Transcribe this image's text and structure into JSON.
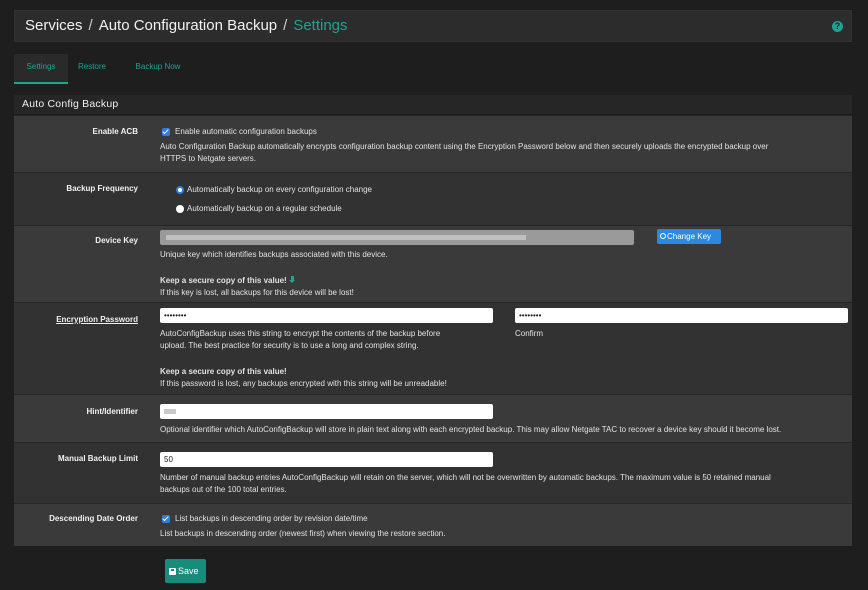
{
  "header": {
    "crumb1": "Services",
    "crumb2": "Auto Configuration Backup",
    "crumb3": "Settings",
    "help_icon": "?"
  },
  "tabs": [
    {
      "label": "Settings",
      "active": true
    },
    {
      "label": "Restore",
      "active": false
    },
    {
      "label": "Backup Now",
      "active": false
    }
  ],
  "panel": {
    "title": "Auto Config Backup"
  },
  "enable_acb": {
    "label": "Enable ACB",
    "checkbox_label": "Enable automatic configuration backups",
    "checked": true,
    "help1": "Auto Configuration Backup automatically encrypts configuration backup content using the Encryption Password below and then securely uploads the encrypted backup over",
    "help2": "HTTPS to Netgate servers."
  },
  "frequency": {
    "label": "Backup Frequency",
    "option1": "Automatically backup on every configuration change",
    "option2": "Automatically backup on a regular schedule",
    "selected": 0
  },
  "device_key": {
    "label": "Device Key",
    "button": "Change Key",
    "help": "Unique key which identifies backups associated with this device.",
    "warn_title": "Keep a secure copy of this value!",
    "warn_text": "If this key is lost, all backups for this device will be lost!"
  },
  "encryption": {
    "label": "Encryption Password",
    "value": "••••••••",
    "confirm_value": "••••••••",
    "confirm_label": "Confirm",
    "help1": "AutoConfigBackup uses this string to encrypt the contents of the backup before",
    "help2": "upload. The best practice for security is to use a long and complex string.",
    "warn_title": "Keep a secure copy of this value!",
    "warn_text": "If this password is lost, any backups encrypted with this string will be unreadable!"
  },
  "hint": {
    "label": "Hint/Identifier",
    "help": "Optional identifier which AutoConfigBackup will store in plain text along with each encrypted backup. This may allow Netgate TAC to recover a device key should it become lost."
  },
  "manual_limit": {
    "label": "Manual Backup Limit",
    "value": "50",
    "help1": "Number of manual backup entries AutoConfigBackup will retain on the server, which will not be overwritten by automatic backups. The maximum value is 50 retained manual",
    "help2": "backups out of the 100 total entries."
  },
  "descending": {
    "label": "Descending Date Order",
    "checkbox_label": "List backups in descending order by revision date/time",
    "checked": true,
    "help": "List backups in descending order (newest first) when viewing the restore section."
  },
  "save_button": "Save",
  "colors": {
    "accent": "#1fa392",
    "primary": "#2b8ae0",
    "save": "#168c7b"
  }
}
